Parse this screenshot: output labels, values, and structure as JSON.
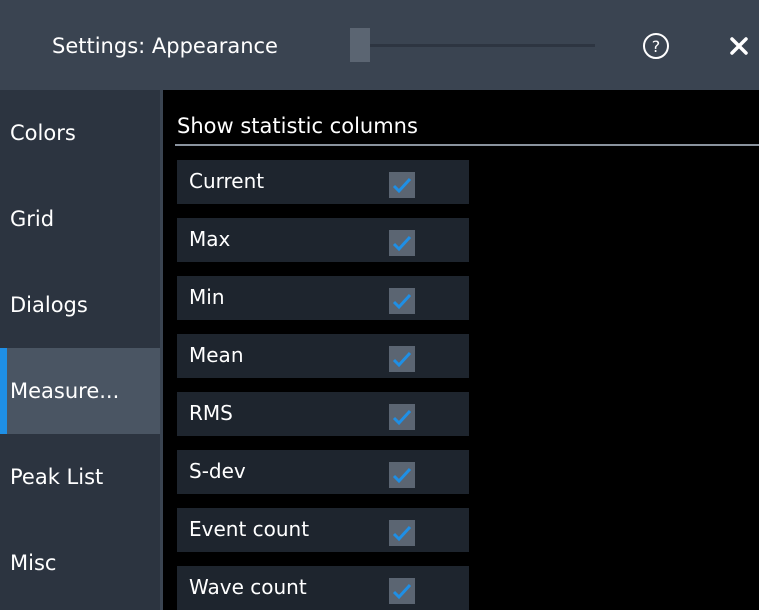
{
  "header": {
    "title": "Settings: Appearance",
    "help_icon": "help-circle-icon",
    "close_icon": "close-icon"
  },
  "sidebar": {
    "items": [
      {
        "label": "Colors",
        "active": false
      },
      {
        "label": "Grid",
        "active": false
      },
      {
        "label": "Dialogs",
        "active": false
      },
      {
        "label": "Measure...",
        "active": true
      },
      {
        "label": "Peak List",
        "active": false
      },
      {
        "label": "Misc",
        "active": false
      }
    ]
  },
  "main": {
    "section_title": "Show statistic columns",
    "rows": [
      {
        "label": "Current",
        "checked": true
      },
      {
        "label": "Max",
        "checked": true
      },
      {
        "label": "Min",
        "checked": true
      },
      {
        "label": "Mean",
        "checked": true
      },
      {
        "label": "RMS",
        "checked": true
      },
      {
        "label": "S-dev",
        "checked": true
      },
      {
        "label": "Event count",
        "checked": true
      },
      {
        "label": "Wave count",
        "checked": true
      }
    ]
  },
  "colors": {
    "accent": "#1f8fe5",
    "titlebar": "#3a4451",
    "sidebar": "#2c3440",
    "active_item": "#4a5563",
    "row": "#1e252e",
    "checkbox": "#5b6572"
  }
}
